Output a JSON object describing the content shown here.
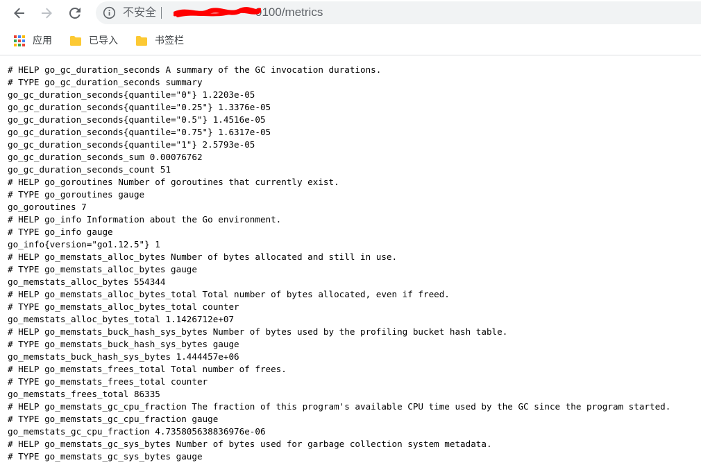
{
  "toolbar": {
    "insecure_label": "不安全",
    "url": "9100/metrics"
  },
  "bookmarks": [
    {
      "label": "应用",
      "icon": "apps-grid-icon"
    },
    {
      "label": "已导入",
      "icon": "folder-icon"
    },
    {
      "label": "书签栏",
      "icon": "folder-icon"
    }
  ],
  "colors": {
    "apps_grid": [
      "#ea4335",
      "#4285f4",
      "#fbbc05",
      "#34a853",
      "#ea4335",
      "#4285f4",
      "#fbbc05",
      "#34a853",
      "#ea4335"
    ],
    "folder": "#fcc934",
    "redaction": "#ff0000"
  },
  "metrics": [
    "# HELP go_gc_duration_seconds A summary of the GC invocation durations.",
    "# TYPE go_gc_duration_seconds summary",
    "go_gc_duration_seconds{quantile=\"0\"} 1.2203e-05",
    "go_gc_duration_seconds{quantile=\"0.25\"} 1.3376e-05",
    "go_gc_duration_seconds{quantile=\"0.5\"} 1.4516e-05",
    "go_gc_duration_seconds{quantile=\"0.75\"} 1.6317e-05",
    "go_gc_duration_seconds{quantile=\"1\"} 2.5793e-05",
    "go_gc_duration_seconds_sum 0.00076762",
    "go_gc_duration_seconds_count 51",
    "# HELP go_goroutines Number of goroutines that currently exist.",
    "# TYPE go_goroutines gauge",
    "go_goroutines 7",
    "# HELP go_info Information about the Go environment.",
    "# TYPE go_info gauge",
    "go_info{version=\"go1.12.5\"} 1",
    "# HELP go_memstats_alloc_bytes Number of bytes allocated and still in use.",
    "# TYPE go_memstats_alloc_bytes gauge",
    "go_memstats_alloc_bytes 554344",
    "# HELP go_memstats_alloc_bytes_total Total number of bytes allocated, even if freed.",
    "# TYPE go_memstats_alloc_bytes_total counter",
    "go_memstats_alloc_bytes_total 1.1426712e+07",
    "# HELP go_memstats_buck_hash_sys_bytes Number of bytes used by the profiling bucket hash table.",
    "# TYPE go_memstats_buck_hash_sys_bytes gauge",
    "go_memstats_buck_hash_sys_bytes 1.444457e+06",
    "# HELP go_memstats_frees_total Total number of frees.",
    "# TYPE go_memstats_frees_total counter",
    "go_memstats_frees_total 86335",
    "# HELP go_memstats_gc_cpu_fraction The fraction of this program's available CPU time used by the GC since the program started.",
    "# TYPE go_memstats_gc_cpu_fraction gauge",
    "go_memstats_gc_cpu_fraction 4.735805638836976e-06",
    "# HELP go_memstats_gc_sys_bytes Number of bytes used for garbage collection system metadata.",
    "# TYPE go_memstats_gc_sys_bytes gauge"
  ]
}
